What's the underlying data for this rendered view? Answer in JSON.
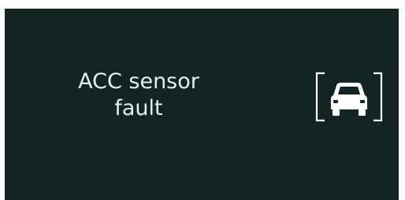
{
  "warning": {
    "message_line1": "ACC sensor",
    "message_line2": "fault",
    "icon": "acc-sensor-car-icon"
  },
  "colors": {
    "background": "#142424",
    "text": "#e8eeee",
    "icon": "#ffffff"
  }
}
